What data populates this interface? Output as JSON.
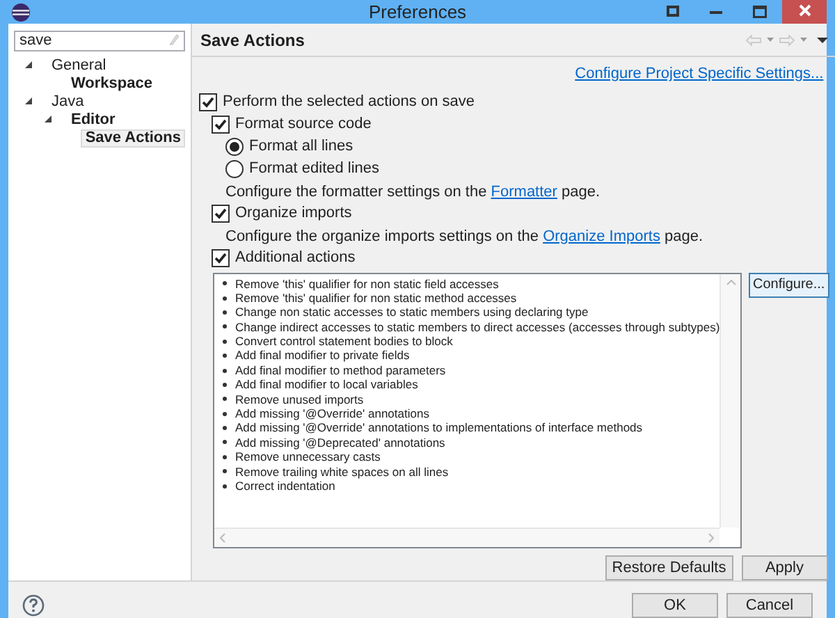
{
  "window": {
    "title": "Preferences"
  },
  "search": {
    "value": "save"
  },
  "tree": [
    {
      "label": "General",
      "bold": false,
      "selected": false,
      "expanded": true,
      "children": [
        {
          "label": "Workspace",
          "bold": true,
          "selected": false
        }
      ]
    },
    {
      "label": "Java",
      "bold": false,
      "selected": false,
      "expanded": true,
      "children": [
        {
          "label": "Editor",
          "bold": true,
          "selected": false,
          "expanded": true,
          "children": [
            {
              "label": "Save Actions",
              "bold": true,
              "selected": true
            }
          ]
        }
      ]
    }
  ],
  "page": {
    "title": "Save Actions",
    "project_link": "Configure Project Specific Settings...",
    "perform": {
      "label": "Perform the selected actions on save",
      "checked": true
    },
    "format": {
      "label": "Format source code",
      "checked": true
    },
    "format_scope": [
      {
        "label": "Format all lines",
        "selected": true
      },
      {
        "label": "Format edited lines",
        "selected": false
      }
    ],
    "format_note": {
      "before": "Configure the formatter settings on the ",
      "link": "Formatter",
      "after": " page."
    },
    "organize": {
      "label": "Organize imports",
      "checked": true
    },
    "organize_note": {
      "before": "Configure the organize imports settings on the ",
      "link": "Organize Imports",
      "after": " page."
    },
    "additional": {
      "label": "Additional actions",
      "checked": true
    },
    "actions": [
      "Remove 'this' qualifier for non static field accesses",
      "Remove 'this' qualifier for non static method accesses",
      "Change non static accesses to static members using declaring type",
      "Change indirect accesses to static members to direct accesses (accesses through subtypes)",
      "Convert control statement bodies to block",
      "Add final modifier to private fields",
      "Add final modifier to method parameters",
      "Add final modifier to local variables",
      "Remove unused imports",
      "Add missing '@Override' annotations",
      "Add missing '@Override' annotations to implementations of interface methods",
      "Add missing '@Deprecated' annotations",
      "Remove unnecessary casts",
      "Remove trailing white spaces on all lines",
      "Correct indentation"
    ],
    "configure": "Configure...",
    "restore_defaults": "Restore Defaults",
    "apply": "Apply"
  },
  "footer": {
    "ok": "OK",
    "cancel": "Cancel"
  }
}
